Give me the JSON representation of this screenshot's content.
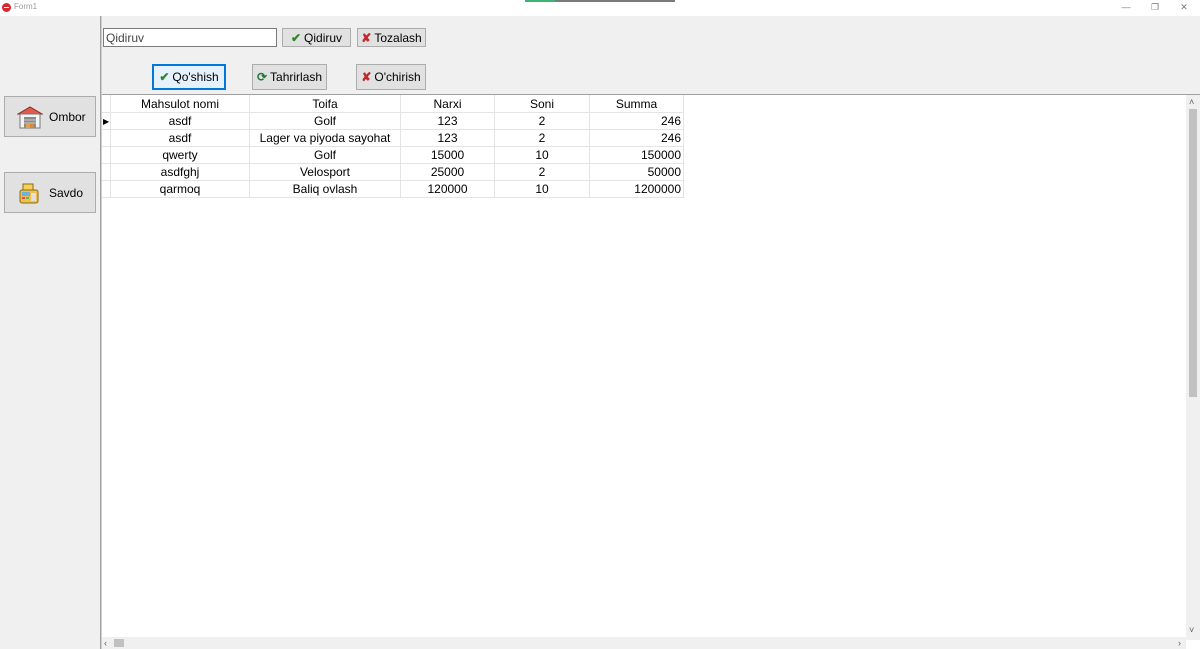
{
  "window": {
    "title": "Form1",
    "minimize_label": "—",
    "maximize_label": "❐",
    "close_label": "✕",
    "loading_progress": 0.2
  },
  "sidebar": {
    "items": [
      {
        "label": "Ombor",
        "icon": "warehouse-icon"
      },
      {
        "label": "Savdo",
        "icon": "cash-register-icon"
      }
    ]
  },
  "search": {
    "value": "Qidiruv",
    "search_button_label": "Qidiruv",
    "clear_button_label": "Tozalash"
  },
  "actions": {
    "add_label": "Qo'shish",
    "edit_label": "Tahrirlash",
    "delete_label": "O'chirish"
  },
  "table": {
    "columns": [
      "Mahsulot nomi",
      "Toifa",
      "Narxi",
      "Soni",
      "Summa"
    ],
    "rows": [
      [
        "asdf",
        "Golf",
        "123",
        "2",
        "246"
      ],
      [
        "asdf",
        "Lager va piyoda sayohat",
        "123",
        "2",
        "246"
      ],
      [
        "qwerty",
        "Golf",
        "15000",
        "10",
        "150000"
      ],
      [
        "asdfghj",
        "Velosport",
        "25000",
        "2",
        "50000"
      ],
      [
        "qarmoq",
        "Baliq ovlash",
        "120000",
        "10",
        "1200000"
      ]
    ],
    "current_row_marker": "▶"
  },
  "colors": {
    "accent": "#0078d7",
    "check_green": "#2b8a2b",
    "delete_red": "#c0282e",
    "progress_green": "#3cb371"
  }
}
